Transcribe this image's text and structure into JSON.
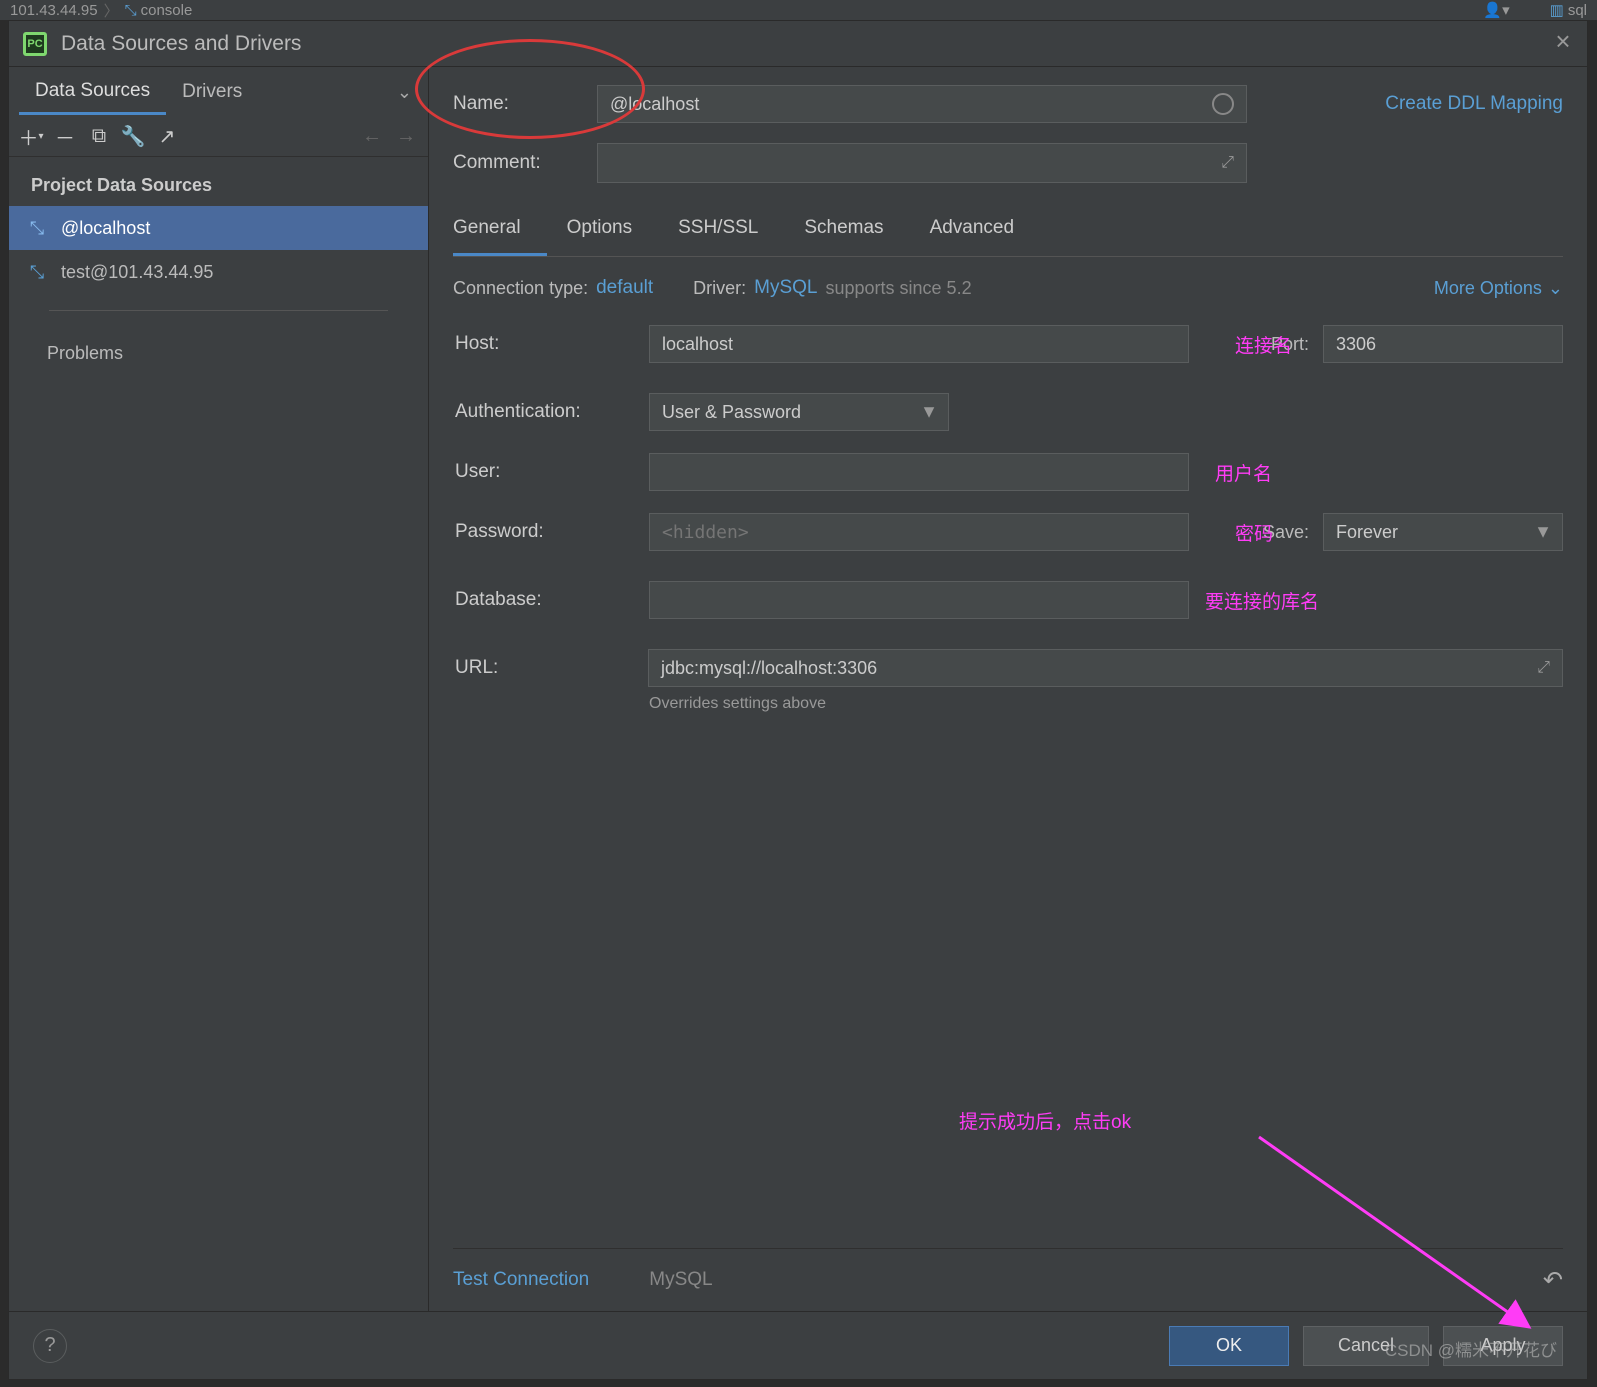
{
  "breadcrumb": {
    "item1": "101.43.44.95",
    "item2": "console",
    "right": "sql"
  },
  "dialog": {
    "title": "Data Sources and Drivers",
    "tabs": {
      "data_sources": "Data Sources",
      "drivers": "Drivers"
    },
    "section_header": "Project Data Sources",
    "items": [
      {
        "label": "@localhost"
      },
      {
        "label": "test@101.43.44.95"
      }
    ],
    "problems": "Problems"
  },
  "form": {
    "name_label": "Name:",
    "name_value": "@localhost",
    "comment_label": "Comment:",
    "create_ddl": "Create DDL Mapping",
    "main_tabs": [
      "General",
      "Options",
      "SSH/SSL",
      "Schemas",
      "Advanced"
    ],
    "conn_type_label": "Connection type:",
    "conn_type_value": "default",
    "driver_label": "Driver:",
    "driver_value": "MySQL",
    "driver_supports": "supports since 5.2",
    "more_options": "More Options",
    "host_label": "Host:",
    "host_value": "localhost",
    "port_label": "Port:",
    "port_value": "3306",
    "auth_label": "Authentication:",
    "auth_value": "User & Password",
    "user_label": "User:",
    "password_label": "Password:",
    "password_placeholder": "<hidden>",
    "save_label": "Save:",
    "save_value": "Forever",
    "database_label": "Database:",
    "url_label": "URL:",
    "url_value": "jdbc:mysql://localhost:3306",
    "override_note": "Overrides settings above",
    "test_connection": "Test Connection",
    "bottom_driver": "MySQL"
  },
  "annotations": {
    "host": "连接名",
    "user": "用户名",
    "password": "密码",
    "database": "要连接的库名",
    "success_hint": "提示成功后，点击ok"
  },
  "footer": {
    "ok": "OK",
    "cancel": "Cancel",
    "apply": "Apply"
  },
  "watermark": "CSDN @糯米不开花び"
}
